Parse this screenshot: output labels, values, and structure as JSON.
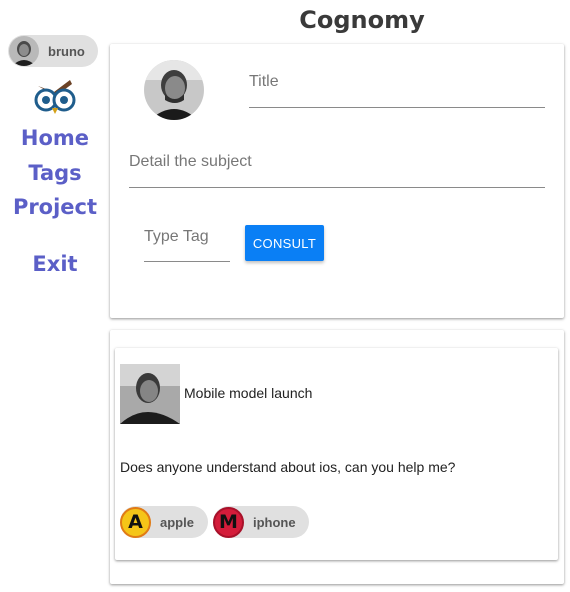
{
  "header": {
    "title": "Cognomy"
  },
  "user": {
    "name": "bruno",
    "avatar_icon": "user-avatar-photo"
  },
  "logo": {
    "icon": "owl-logo-icon"
  },
  "nav": {
    "home": "Home",
    "tags": "Tags",
    "project": "Project",
    "exit": "Exit"
  },
  "form": {
    "title_placeholder": "Title",
    "detail_placeholder": "Detail the subject",
    "tag_placeholder": "Type Tag",
    "consult_label": "CONSULT"
  },
  "post": {
    "title": "Mobile model launch",
    "body": "Does anyone understand about ios, can you help me?",
    "tags": [
      {
        "letter": "A",
        "label": "apple",
        "color": "#f5c518"
      },
      {
        "letter": "M",
        "label": "iphone",
        "color": "#d41c3a"
      }
    ]
  },
  "colors": {
    "accent": "#0a7ff5",
    "nav": "#5b5fc7",
    "chip": "#e0e0e0"
  }
}
